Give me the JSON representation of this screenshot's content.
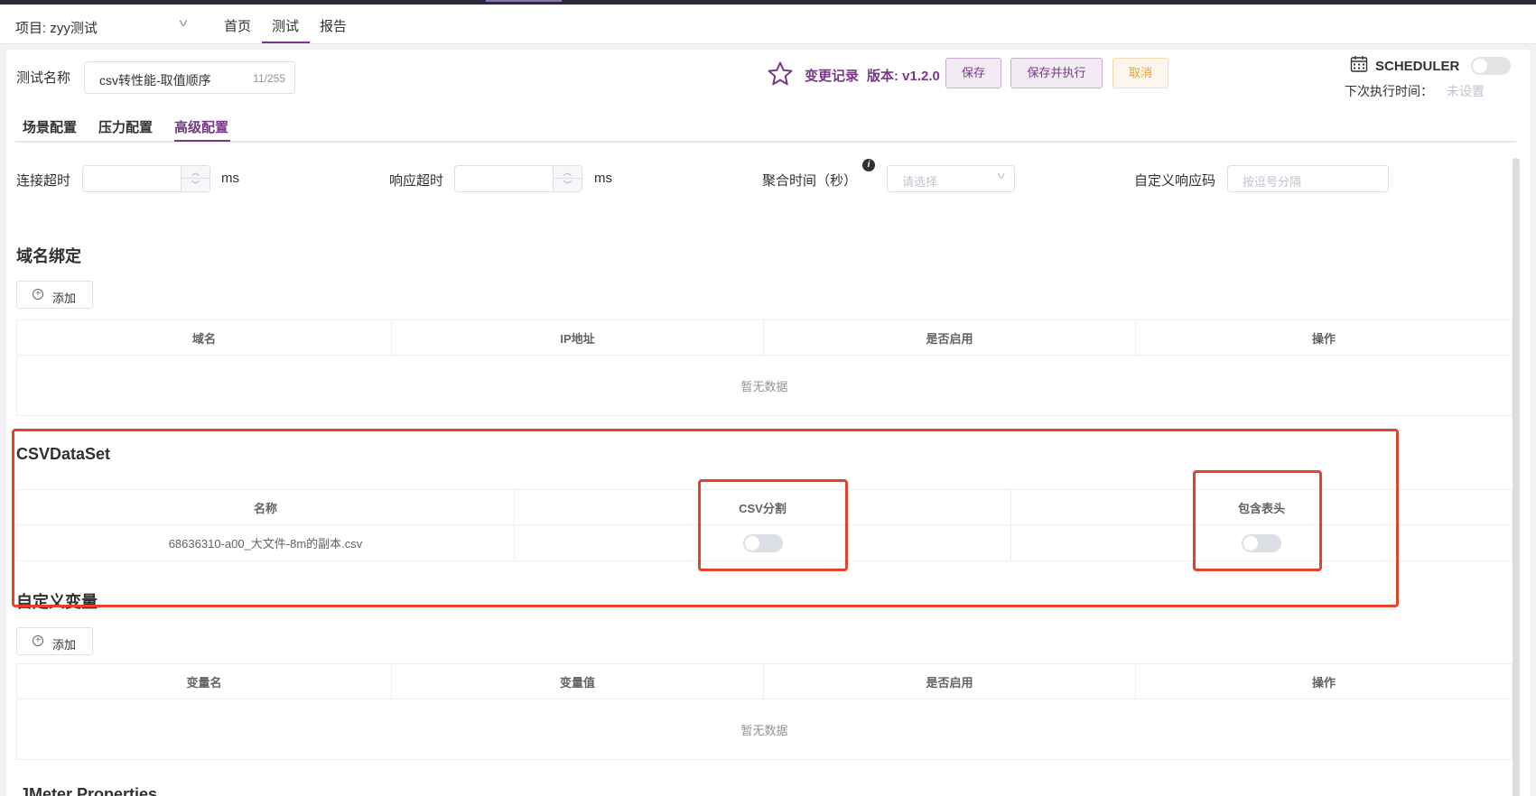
{
  "navbar": {
    "project": "项目: zyy测试",
    "items": [
      "首页",
      "测试",
      "报告"
    ]
  },
  "header": {
    "name_label": "测试名称",
    "name_value": "csv转性能-取值顺序",
    "name_count": "11/255",
    "history_label": "变更记录",
    "version_label": "版本: v1.2.0",
    "save_label": "保存",
    "save_run_label": "保存并执行",
    "cancel_label": "取消",
    "scheduler_label": "SCHEDULER",
    "next_label": "下次执行时间：",
    "next_value": "未设置"
  },
  "tabs": [
    "场景配置",
    "压力配置",
    "高级配置"
  ],
  "settings": {
    "connect_timeout_label": "连接超时",
    "response_timeout_label": "响应超时",
    "unit": "ms",
    "aggregate_label": "聚合时间（秒）",
    "aggregate_placeholder": "请选择",
    "response_code_label": "自定义响应码",
    "response_code_placeholder": "按逗号分隔"
  },
  "domain_binding": {
    "title": "域名绑定",
    "add_label": "添加",
    "columns": [
      "域名",
      "IP地址",
      "是否启用",
      "操作"
    ],
    "empty_text": "暂无数据"
  },
  "csv_dataset": {
    "title": "CSVDataSet",
    "columns": [
      "名称",
      "CSV分割",
      "包含表头"
    ],
    "rows": [
      {
        "name": "68636310-a00_大文件-8m的副本.csv"
      }
    ]
  },
  "custom_vars": {
    "title": "自定义变量",
    "add_label": "添加",
    "columns": [
      "变量名",
      "变量值",
      "是否启用",
      "操作"
    ],
    "empty_text": "暂无数据"
  },
  "jmeter": {
    "title": "JMeter Properties"
  },
  "colors": {
    "accent": "#783887",
    "highlight": "#e1432b"
  }
}
